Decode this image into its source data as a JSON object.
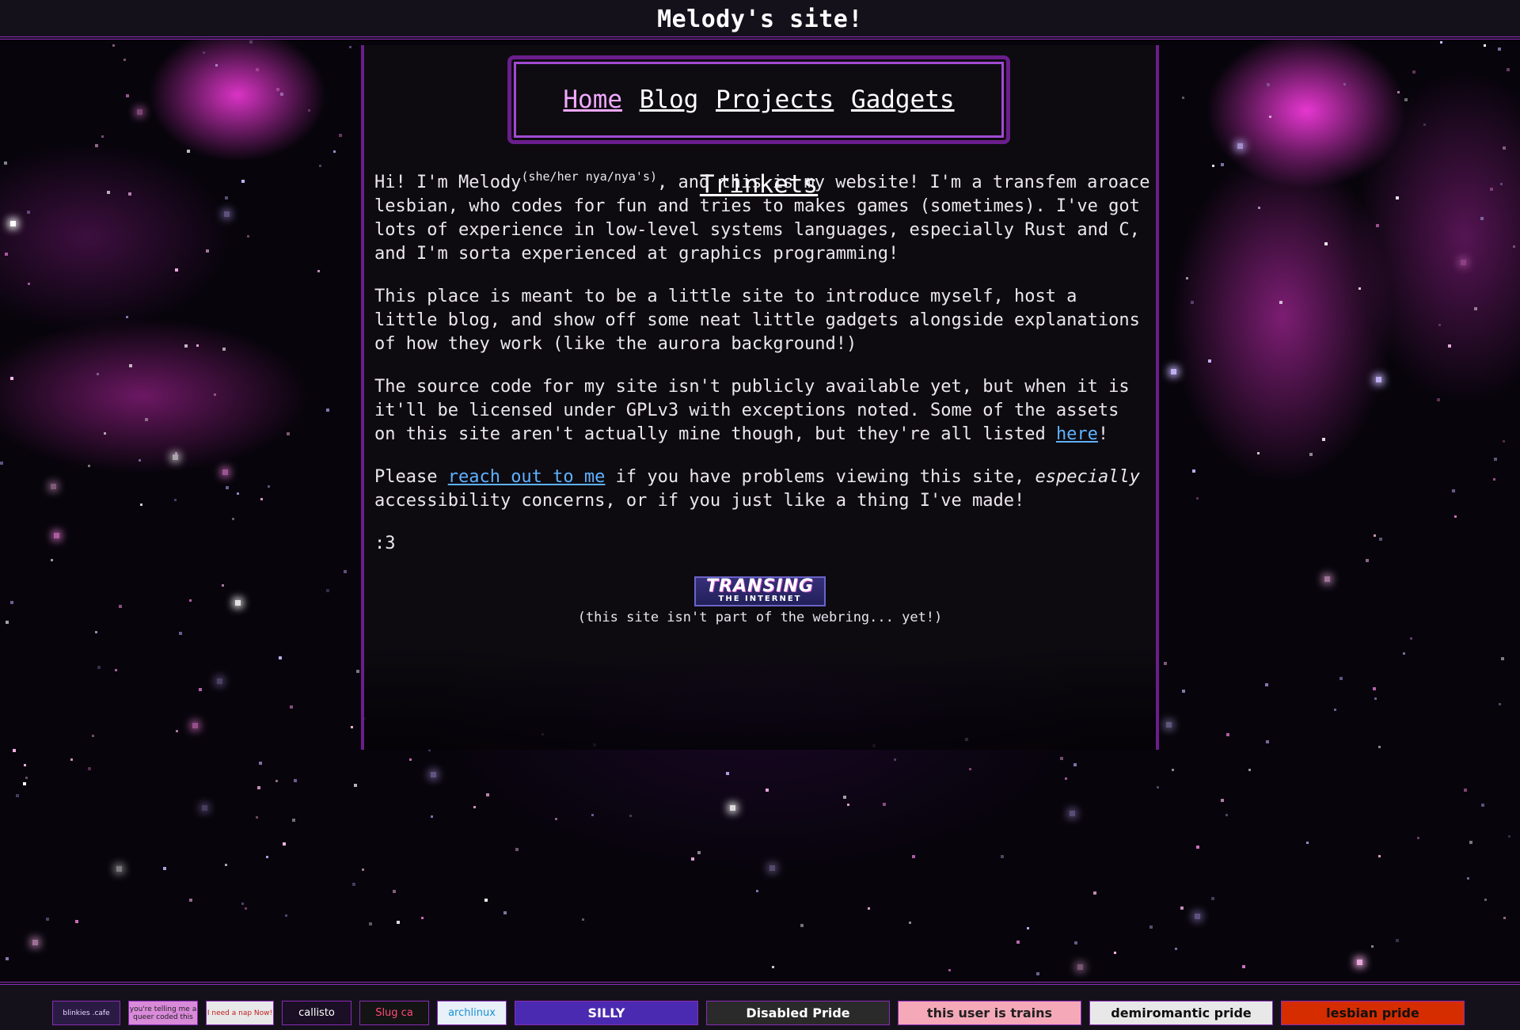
{
  "header": {
    "title": "Melody's site!"
  },
  "nav": {
    "items": [
      {
        "label": "Home",
        "active": true
      },
      {
        "label": "Blog",
        "active": false
      },
      {
        "label": "Projects",
        "active": false
      },
      {
        "label": "Gadgets",
        "active": false
      },
      {
        "label": "Trinkets",
        "active": false
      }
    ]
  },
  "intro": {
    "p1_a": "Hi! I'm Melody",
    "pronouns": "(she/her nya/nya's)",
    "p1_b": ", and this is my website! I'm a transfem aroace lesbian, who codes for fun and tries to makes games (sometimes). I've got lots of experience in low-level systems languages, especially Rust and C, and I'm sorta experienced at graphics programming!",
    "p2": "This place is meant to be a little site to introduce myself, host a little blog, and show off some neat little gadgets alongside explanations of how they work (like the aurora background!)",
    "p3_a": "The source code for my site isn't publicly available yet, but when it is it'll be licensed under GPLv3 with exceptions noted. Some of the assets on this site aren't actually mine though, but they're all listed ",
    "p3_link": "here",
    "p3_b": "!",
    "p4_a": "Please ",
    "p4_link": "reach out to me",
    "p4_b": " if you have problems viewing this site, ",
    "p4_em": "especially",
    "p4_c": " accessibility concerns, or if you just like a thing I've made!",
    "p5": ":3"
  },
  "webring": {
    "badge_line1": "TRANSING",
    "badge_line2": "THE INTERNET",
    "note": "(this site isn't part of the webring... yet!)"
  },
  "footer_buttons": [
    {
      "name": "blinkies-cafe",
      "text": "blinkies .cafe",
      "bg": "#2a1b44",
      "fg": "#e6d8ff"
    },
    {
      "name": "queer-coded",
      "text": "you're telling me a queer coded this",
      "bg": "#d98ad9",
      "fg": "#202020"
    },
    {
      "name": "need-a-nap",
      "text": "I need a nap Now!",
      "bg": "#e8e8e8",
      "fg": "#c02020"
    },
    {
      "name": "callisto",
      "text": "callisto",
      "bg": "#1a0f24",
      "fg": "#ffffff"
    },
    {
      "name": "slug-cat",
      "text": "Slug ca",
      "bg": "#141414",
      "fg": "#ff4a7a"
    },
    {
      "name": "archlinux",
      "text": "archlinux",
      "bg": "#e8f0f8",
      "fg": "#1793d1"
    },
    {
      "name": "silly",
      "text": "SILLY",
      "bg": "#4a2ab0",
      "fg": "#ffffff"
    },
    {
      "name": "disabled-pride",
      "text": "Disabled Pride",
      "bg": "#2a2a2a",
      "fg": "#ffffff"
    },
    {
      "name": "user-is-trains",
      "text": "this user is trains",
      "bg": "#f5a9b8",
      "fg": "#202020"
    },
    {
      "name": "demiromantic-pride",
      "text": "demiromantic pride",
      "bg": "#e8e8e8",
      "fg": "#101010"
    },
    {
      "name": "lesbian-pride",
      "text": "lesbian pride",
      "bg": "#d52d00",
      "fg": "#101010"
    }
  ],
  "colors": {
    "accent_border": "#6a1e8c",
    "link": "#5fb1ff",
    "nav_active": "#f0a8ff",
    "panel_bg": "#0d0b10"
  }
}
